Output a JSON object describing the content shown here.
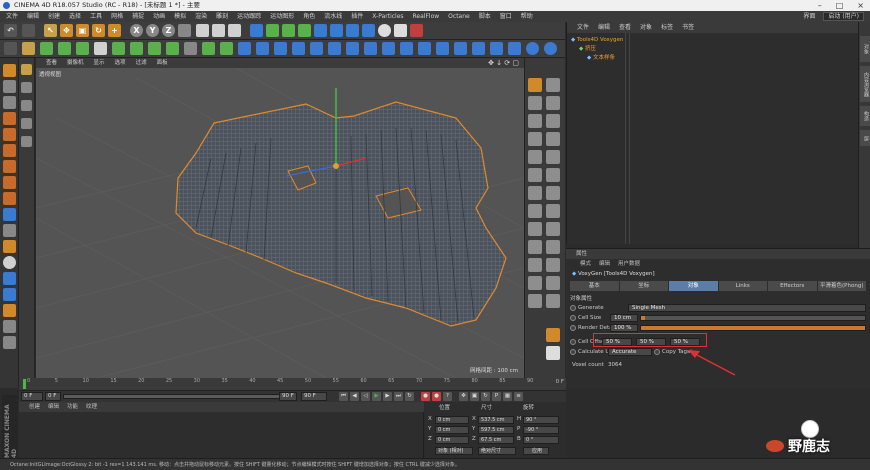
{
  "window": {
    "title": "CINEMA 4D R18.057 Studio (RC - R18) - [未标题 1 *] - 主要"
  },
  "menubar": {
    "items": [
      "文件",
      "编辑",
      "创建",
      "选择",
      "工具",
      "网格",
      "捕捉",
      "动画",
      "模拟",
      "渲染",
      "雕刻",
      "运动跟踪",
      "运动图形",
      "角色",
      "流水线",
      "插件",
      "X-Particles",
      "RealFlow",
      "Octane",
      "脚本",
      "窗口",
      "帮助"
    ],
    "right_label": "界面",
    "layout_value": "启动 (用户)"
  },
  "viewport": {
    "menu": [
      "查看",
      "摄像机",
      "显示",
      "选项",
      "过滤",
      "面板"
    ],
    "label": "透视视图",
    "grid_info": "网格间距 : 100 cm"
  },
  "object_manager": {
    "tabs": [
      "文件",
      "编辑",
      "查看",
      "对象",
      "标签",
      "书签"
    ],
    "rows": [
      {
        "name": "Tools4D Voxygen",
        "level": 0
      },
      {
        "name": "挤压",
        "level": 1
      },
      {
        "name": "文本样条",
        "level": 2
      }
    ]
  },
  "side_tabs": [
    "对象",
    "内容浏览器",
    "构造",
    "层"
  ],
  "attributes": {
    "title": "属性",
    "modes": [
      "模式",
      "编辑",
      "用户数据"
    ],
    "object_label": "VoxyGen [Tools4D Voxygen]",
    "tabs": [
      "基本",
      "坐标",
      "对象",
      "Links",
      "Effectors",
      "平滑着色(Phong)"
    ],
    "active_tab": 2,
    "section": "对象属性",
    "generate_label": "Generate",
    "generate_value": "Single Mesh",
    "cell_size_label": "Cell Size",
    "cell_size_value": "10 cm",
    "render_detail_label": "Render Detail",
    "render_detail_value": "100 %",
    "render_detail_fraction": 1.0,
    "cell_offset_label": "Cell Offset",
    "cell_offset_values": [
      "50 %",
      "50 %",
      "50 %"
    ],
    "calculate_uv_label": "Calculate UV",
    "calculate_uv_value": "Accurate",
    "copy_tags_label": "Copy Tags",
    "voxel_count_label": "Voxel count",
    "voxel_count_value": "3064"
  },
  "timeline": {
    "ticks": [
      "0",
      "5",
      "10",
      "15",
      "20",
      "25",
      "30",
      "35",
      "40",
      "45",
      "50",
      "55",
      "60",
      "65",
      "70",
      "75",
      "80",
      "85",
      "90"
    ],
    "end_label": "0 F"
  },
  "transport": {
    "start": "0 F",
    "current": "0 F",
    "end": "90 F",
    "end2": "90 F"
  },
  "material_manager": {
    "tabs": [
      "创建",
      "编辑",
      "功能",
      "纹理"
    ]
  },
  "coordinates": {
    "headers": [
      "位置",
      "尺寸",
      "旋转"
    ],
    "rows": [
      {
        "axis": "X",
        "pos": "0 cm",
        "size": "537.5 cm",
        "rot_label": "H",
        "rot": "90 °"
      },
      {
        "axis": "Y",
        "pos": "0 cm",
        "size": "597.5 cm",
        "rot_label": "P",
        "rot": "-90 °"
      },
      {
        "axis": "Z",
        "pos": "0 cm",
        "size": "67.5 cm",
        "rot_label": "B",
        "rot": "0 °"
      }
    ],
    "mode_select": "对象 (相对)",
    "size_select": "绝对尺寸",
    "apply_button": "应用"
  },
  "brand": "MAXON CINEMA 4D",
  "status": "Octane:InitGLImage:OctGlossy 2: bit -1 res=1  143.141 ms.  移动：点击并拖动鼠标移动元素。按住 SHIFT 键量化移动；节点编辑模式时按住 SHIFT 键增加选择对象；按住 CTRL 键减少选择对象。",
  "watermark": "野鹿志",
  "colors": {
    "accent": "#5a7ea8",
    "highlight": "#e03030",
    "object_orange": "#f0a030"
  }
}
